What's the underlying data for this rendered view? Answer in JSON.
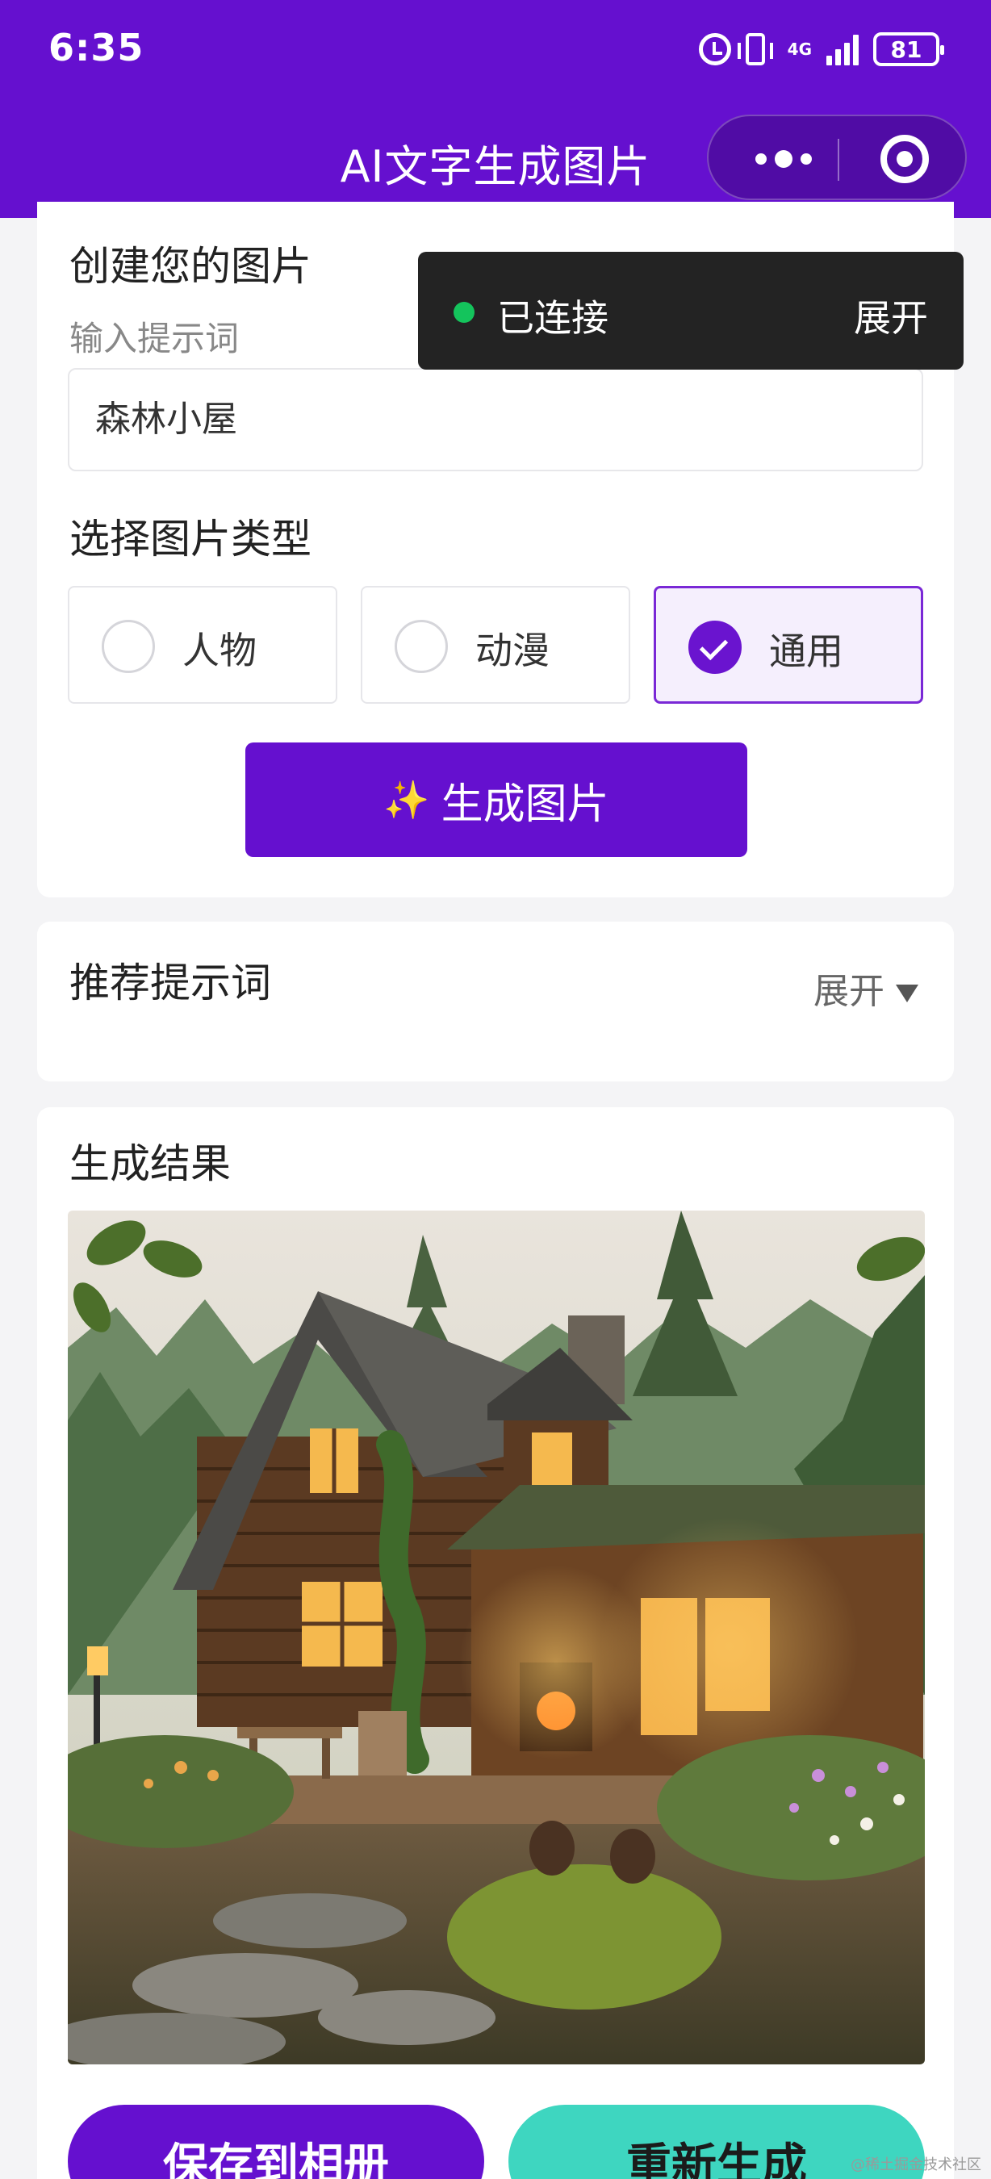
{
  "status_bar": {
    "time": "6:35",
    "network": "4G",
    "battery": "81"
  },
  "nav": {
    "title": "AI文字生成图片",
    "more_icon": "more-dots-icon",
    "close_icon": "target-icon"
  },
  "create_card": {
    "title": "创建您的图片",
    "prompt_hint": "输入提示词",
    "prompt_value": "森林小屋",
    "type_title": "选择图片类型",
    "types": [
      {
        "label": "人物",
        "selected": false
      },
      {
        "label": "动漫",
        "selected": false
      },
      {
        "label": "通用",
        "selected": true
      }
    ],
    "generate_icon": "✨",
    "generate_label": "生成图片"
  },
  "toast": {
    "status": "已连接",
    "action": "展开",
    "status_color": "#14c45c"
  },
  "recommend_card": {
    "title": "推荐提示词",
    "expand_label": "展开"
  },
  "result_card": {
    "title": "生成结果",
    "image": "generated-forest-cabin-image"
  },
  "actions": {
    "save_label": "保存到相册",
    "regenerate_label": "重新生成"
  },
  "watermark": "@稀土掘金技术社区",
  "colors": {
    "brand": "#6510cf",
    "accent_teal": "#3ed6c0",
    "toast_bg": "#232323"
  }
}
